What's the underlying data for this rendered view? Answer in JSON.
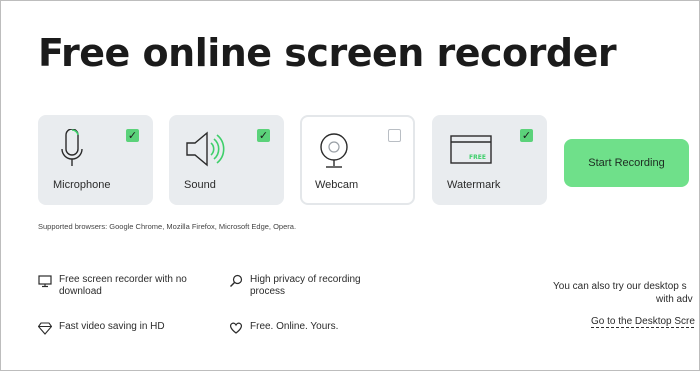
{
  "page": {
    "title": "Free online screen recorder",
    "supported_browsers": "Supported browsers: Google Chrome, Mozilla Firefox, Microsoft Edge, Opera."
  },
  "options": [
    {
      "label": "Microphone",
      "checked": true,
      "icon": "microphone-icon"
    },
    {
      "label": "Sound",
      "checked": true,
      "icon": "speaker-icon"
    },
    {
      "label": "Webcam",
      "checked": false,
      "icon": "webcam-icon"
    },
    {
      "label": "Watermark",
      "checked": true,
      "icon": "watermark-icon",
      "badge": "FREE"
    }
  ],
  "start_button": {
    "label": "Start Recording"
  },
  "features": [
    {
      "line1": "Free screen recorder with no",
      "line2": "download",
      "icon": "monitor-icon"
    },
    {
      "line1": "High privacy of recording",
      "line2": "process",
      "icon": "magnifier-icon"
    },
    {
      "line1": "Fast video saving in HD",
      "icon": "diamond-icon"
    },
    {
      "line1": "Free. Online. Yours.",
      "icon": "heart-icon"
    }
  ],
  "desktop": {
    "line1": "You can also try our desktop s",
    "line2": "with adv",
    "link": "Go to the Desktop Scre"
  },
  "colors": {
    "accent": "#6fe08a",
    "check": "#5bd27a",
    "card_bg": "#e9ecef",
    "icon_green": "#3ecf6a"
  }
}
